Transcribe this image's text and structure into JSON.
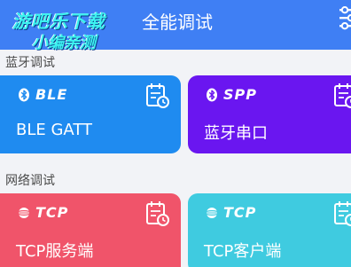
{
  "header": {
    "title": "全能调试",
    "watermark_line1": "游吧乐下载",
    "watermark_line2": "小编亲测"
  },
  "sections": [
    {
      "label": "蓝牙调试",
      "cards": [
        {
          "protocol": "BLE",
          "title": "BLE GATT",
          "color": "#1f8bf0",
          "icon": "bluetooth-icon"
        },
        {
          "protocol": "SPP",
          "title": "蓝牙串口",
          "color": "#6a16f0",
          "icon": "bluetooth-icon"
        }
      ]
    },
    {
      "label": "网络调试",
      "cards": [
        {
          "protocol": "TCP",
          "title": "TCP服务端",
          "color": "#f0546a",
          "icon": "network-icon"
        },
        {
          "protocol": "TCP",
          "title": "TCP客户端",
          "color": "#3fcbe0",
          "icon": "network-icon"
        }
      ]
    }
  ],
  "colors": {
    "header_bg": "#3f7ff4",
    "page_bg": "#f2f3f7"
  }
}
